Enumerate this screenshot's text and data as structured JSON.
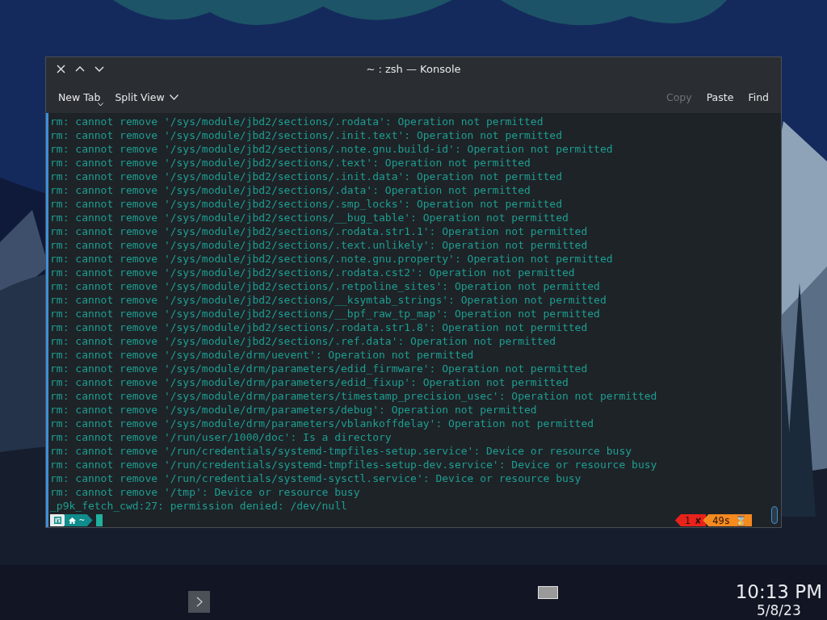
{
  "window": {
    "title": "~ : zsh — Konsole"
  },
  "toolbar": {
    "left": [
      {
        "label": "New Tab",
        "kind": "caret",
        "disabled": false
      },
      {
        "label": "Split View",
        "kind": "chevron",
        "disabled": false
      }
    ],
    "right": [
      {
        "label": "Copy",
        "disabled": true
      },
      {
        "label": "Paste",
        "disabled": false
      },
      {
        "label": "Find",
        "disabled": false
      }
    ]
  },
  "terminal": {
    "lines": [
      "rm: cannot remove '/sys/module/jbd2/sections/.rodata': Operation not permitted",
      "rm: cannot remove '/sys/module/jbd2/sections/.init.text': Operation not permitted",
      "rm: cannot remove '/sys/module/jbd2/sections/.note.gnu.build-id': Operation not permitted",
      "rm: cannot remove '/sys/module/jbd2/sections/.text': Operation not permitted",
      "rm: cannot remove '/sys/module/jbd2/sections/.init.data': Operation not permitted",
      "rm: cannot remove '/sys/module/jbd2/sections/.data': Operation not permitted",
      "rm: cannot remove '/sys/module/jbd2/sections/.smp_locks': Operation not permitted",
      "rm: cannot remove '/sys/module/jbd2/sections/__bug_table': Operation not permitted",
      "rm: cannot remove '/sys/module/jbd2/sections/.rodata.str1.1': Operation not permitted",
      "rm: cannot remove '/sys/module/jbd2/sections/.text.unlikely': Operation not permitted",
      "rm: cannot remove '/sys/module/jbd2/sections/.note.gnu.property': Operation not permitted",
      "rm: cannot remove '/sys/module/jbd2/sections/.rodata.cst2': Operation not permitted",
      "rm: cannot remove '/sys/module/jbd2/sections/.retpoline_sites': Operation not permitted",
      "rm: cannot remove '/sys/module/jbd2/sections/__ksymtab_strings': Operation not permitted",
      "rm: cannot remove '/sys/module/jbd2/sections/__bpf_raw_tp_map': Operation not permitted",
      "rm: cannot remove '/sys/module/jbd2/sections/.rodata.str1.8': Operation not permitted",
      "rm: cannot remove '/sys/module/jbd2/sections/.ref.data': Operation not permitted",
      "rm: cannot remove '/sys/module/drm/uevent': Operation not permitted",
      "rm: cannot remove '/sys/module/drm/parameters/edid_firmware': Operation not permitted",
      "rm: cannot remove '/sys/module/drm/parameters/edid_fixup': Operation not permitted",
      "rm: cannot remove '/sys/module/drm/parameters/timestamp_precision_usec': Operation not permitted",
      "rm: cannot remove '/sys/module/drm/parameters/debug': Operation not permitted",
      "rm: cannot remove '/sys/module/drm/parameters/vblankoffdelay': Operation not permitted",
      "rm: cannot remove '/run/user/1000/doc': Is a directory",
      "rm: cannot remove '/run/credentials/systemd-tmpfiles-setup.service': Device or resource busy",
      "rm: cannot remove '/run/credentials/systemd-tmpfiles-setup-dev.service': Device or resource busy",
      "rm: cannot remove '/run/credentials/systemd-sysctl.service': Device or resource busy",
      "rm: cannot remove '/tmp': Device or resource busy",
      "_p9k_fetch_cwd:27: permission denied: /dev/null"
    ],
    "prompt": {
      "left": [
        {
          "kind": "os",
          "color": "#e8ecec"
        },
        {
          "kind": "dir",
          "text": "~",
          "color": "#0f8c8c"
        }
      ],
      "right": [
        {
          "text": "1",
          "symbol": "✘",
          "color": "#e8231c"
        },
        {
          "text": "49s",
          "symbol": "⌛",
          "color": "#f58a1f"
        }
      ]
    }
  },
  "taskbar": {
    "time": "10:13 PM",
    "date": "5/8/23"
  }
}
